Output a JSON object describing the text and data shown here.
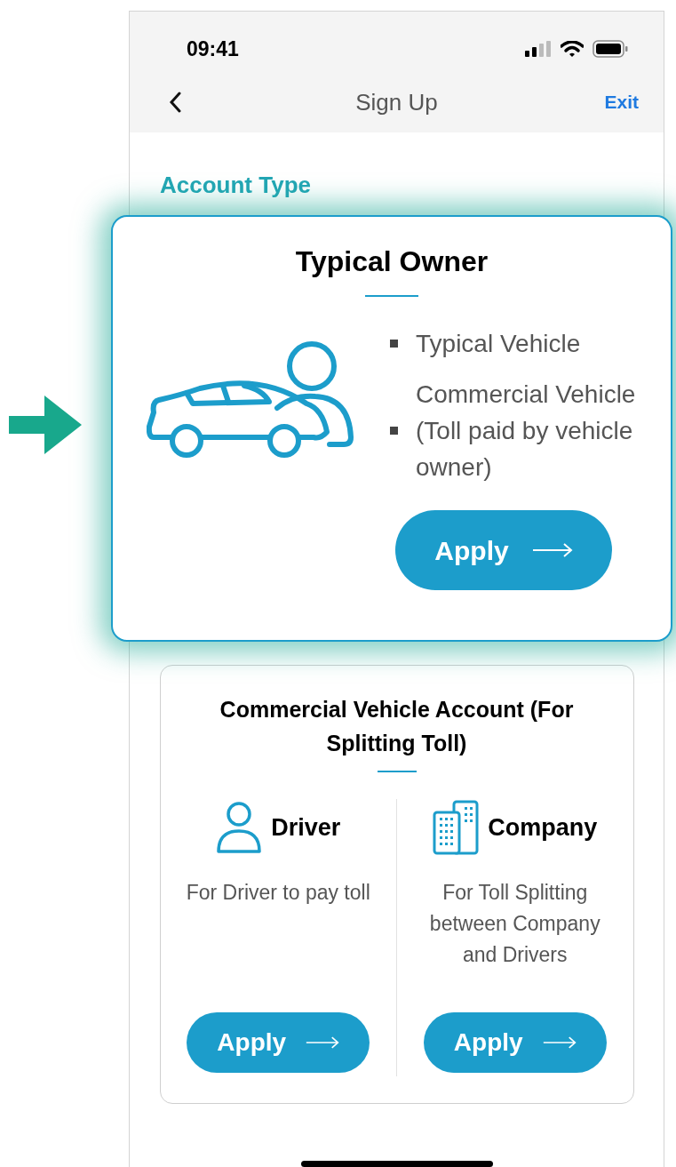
{
  "status_bar": {
    "time": "09:41"
  },
  "nav": {
    "title": "Sign Up",
    "exit": "Exit"
  },
  "section_title": "Account Type",
  "featured_card": {
    "title": "Typical Owner",
    "bullets": [
      "Typical Vehicle",
      "Commercial Vehicle (Toll paid by vehicle owner)"
    ],
    "button": "Apply"
  },
  "commercial_card": {
    "title": "Commercial Vehicle Account (For Splitting Toll)",
    "options": [
      {
        "kind": "driver",
        "title": "Driver",
        "description": "For Driver to pay toll",
        "button": "Apply"
      },
      {
        "kind": "company",
        "title": "Company",
        "description": "For Toll Splitting between Company and Drivers",
        "button": "Apply"
      }
    ]
  }
}
